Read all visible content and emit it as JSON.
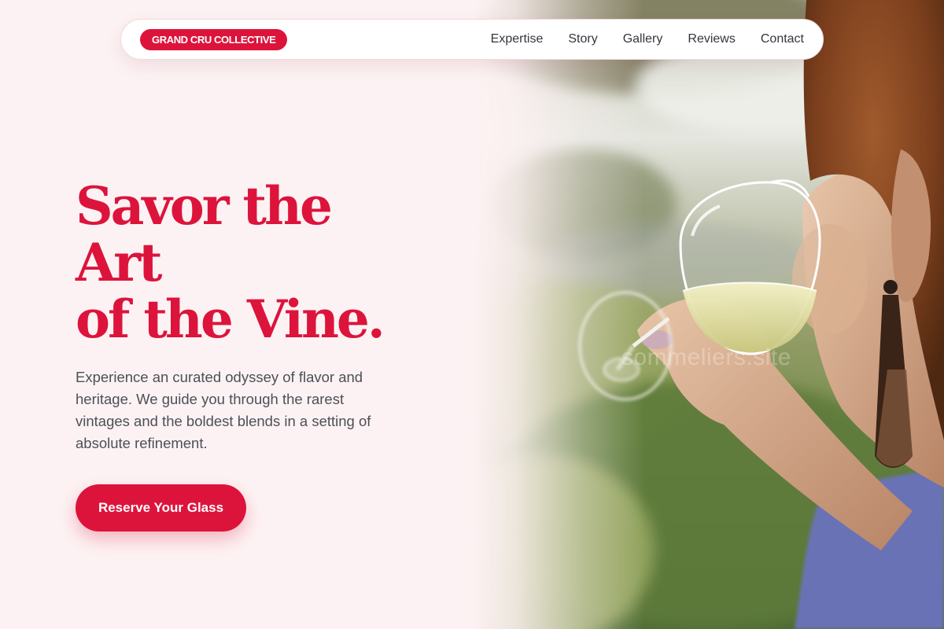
{
  "brand": {
    "name": "GRAND CRU COLLECTIVE"
  },
  "nav": {
    "items": [
      {
        "label": "Expertise"
      },
      {
        "label": "Story"
      },
      {
        "label": "Gallery"
      },
      {
        "label": "Reviews"
      },
      {
        "label": "Contact"
      }
    ]
  },
  "hero": {
    "headline_lines": [
      "Savor the",
      "Art",
      "of the Vine."
    ],
    "subtitle": "Experience an curated odyssey of flavor and heritage. We guide you through the rarest vintages and the boldest blends in a setting of absolute refinement.",
    "cta_label": "Reserve Your Glass",
    "image_watermark": "sommeliers.site"
  },
  "colors": {
    "accent": "#dc143c",
    "page_background": "#fdf2f3",
    "body_text": "#4b5058",
    "nav_text": "#33363d"
  },
  "icons": {
    "hero_image": "woman-drinking-white-wine-photo"
  }
}
